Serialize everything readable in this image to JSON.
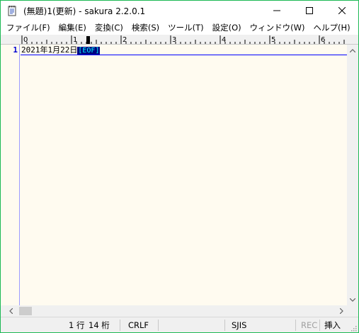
{
  "window": {
    "title": "(無題)1(更新) - sakura 2.2.0.1",
    "border_color": "#1db954",
    "controls": {
      "minimize_icon": "minimize-icon",
      "maximize_icon": "maximize-icon",
      "close_icon": "close-icon"
    }
  },
  "menu": {
    "items": [
      {
        "label": "ファイル(F)"
      },
      {
        "label": "編集(E)"
      },
      {
        "label": "変換(C)"
      },
      {
        "label": "検索(S)"
      },
      {
        "label": "ツール(T)"
      },
      {
        "label": "設定(O)"
      },
      {
        "label": "ウィンドウ(W)"
      },
      {
        "label": "ヘルプ(H)"
      }
    ]
  },
  "ruler": {
    "labels": [
      "0",
      "1",
      "2",
      "3",
      "4",
      "5",
      "6"
    ]
  },
  "editor": {
    "background": "#fffbf0",
    "lines": [
      {
        "number": "1",
        "text": "2021年1月22日",
        "eof": "[EOF]"
      }
    ]
  },
  "statusbar": {
    "line": "1 行",
    "column": "14 桁",
    "eol": "CRLF",
    "encoding": "SJIS",
    "rec": "REC",
    "mode": "挿入"
  }
}
